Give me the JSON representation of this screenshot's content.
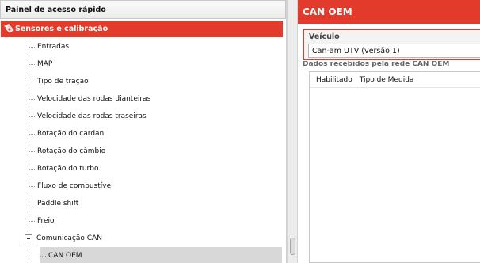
{
  "left_panel": {
    "title": "Painel de acesso rápido",
    "root": {
      "label": "Sensores e calibração",
      "icon": "sensor-icon"
    },
    "items": [
      {
        "label": "Entradas"
      },
      {
        "label": "MAP"
      },
      {
        "label": "Tipo de tração"
      },
      {
        "label": "Velocidade das rodas dianteiras"
      },
      {
        "label": "Velocidade das rodas traseiras"
      },
      {
        "label": "Rotação do cardan"
      },
      {
        "label": "Rotação do câmbio"
      },
      {
        "label": "Rotação do turbo"
      },
      {
        "label": "Fluxo de combustível"
      },
      {
        "label": "Paddle shift"
      },
      {
        "label": "Freio"
      },
      {
        "label": "Comunicação CAN"
      }
    ],
    "sub_items": [
      {
        "label": "CAN OEM"
      }
    ]
  },
  "right_panel": {
    "title": "CAN OEM",
    "vehicle": {
      "label": "Veículo",
      "selected": "Can-am UTV (versão 1)"
    },
    "data_section": {
      "label": "Dados recebidos pela rede CAN OEM",
      "columns": [
        "Habilitado",
        "Tipo de Medida"
      ]
    }
  },
  "colors": {
    "accent": "#e23a2b",
    "selected_row": "#d8d8d8"
  }
}
